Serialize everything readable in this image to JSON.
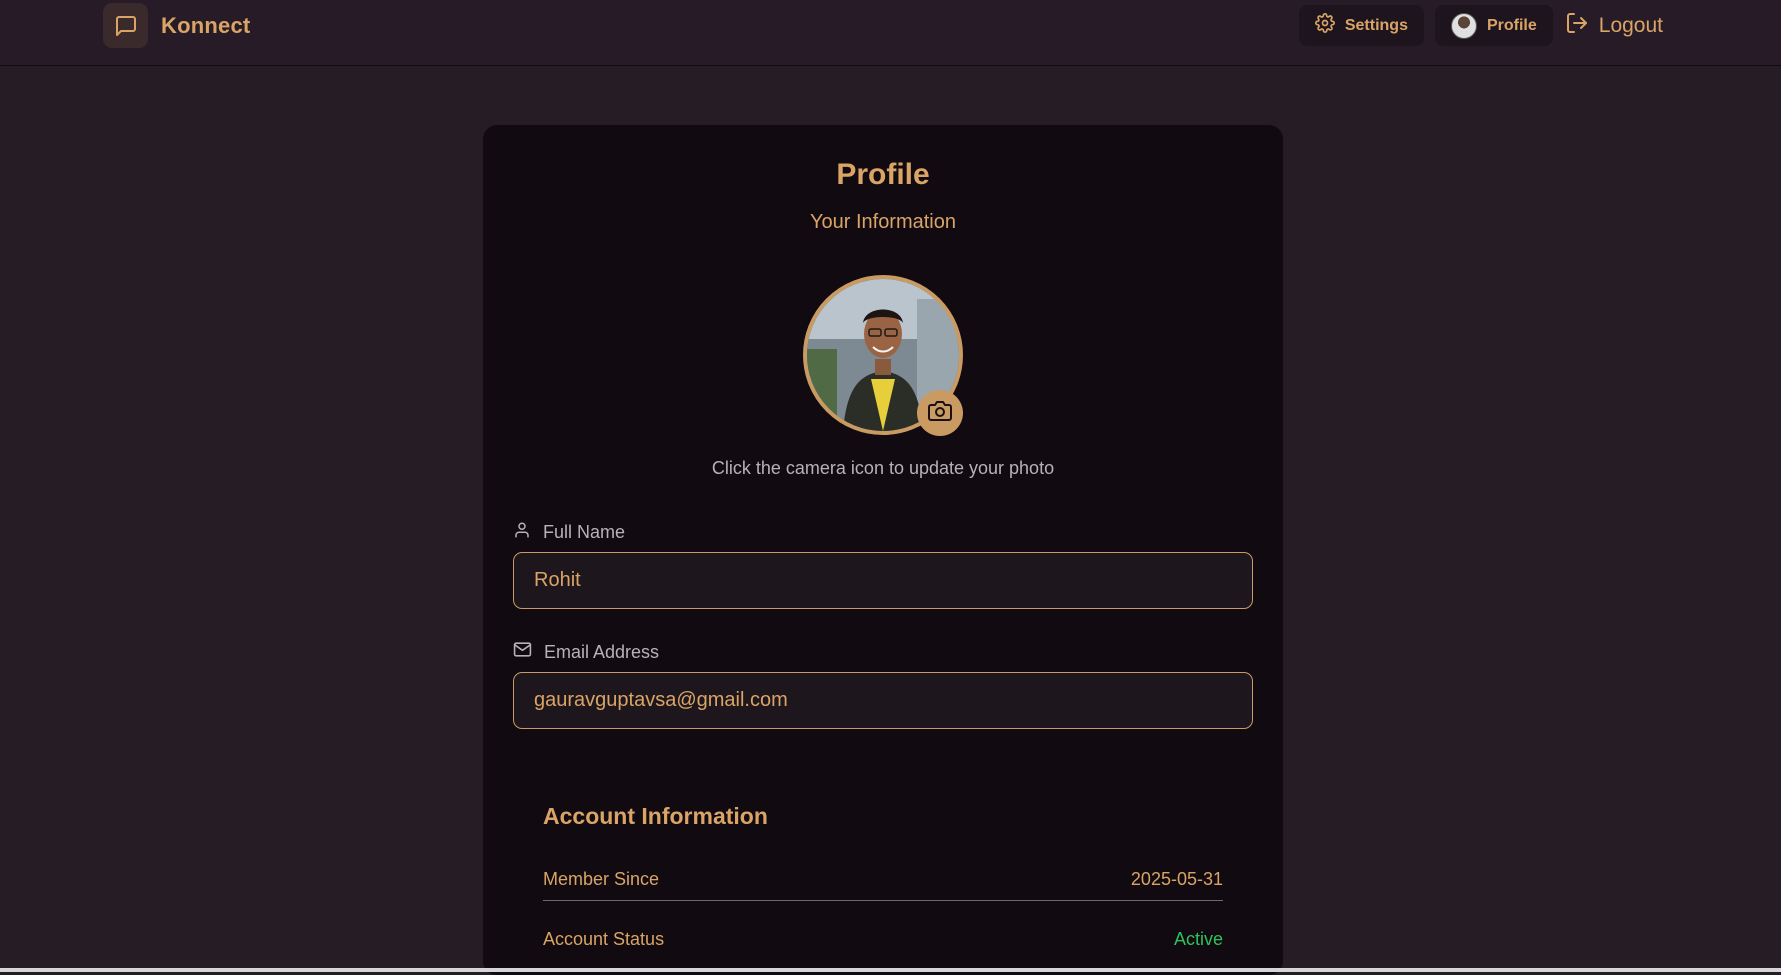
{
  "app": {
    "name": "Konnect",
    "brand_icon": "message-square-icon",
    "accent_color": "#d9a466"
  },
  "nav": {
    "settings_label": "Settings",
    "settings_icon": "gear-icon",
    "profile_label": "Profile",
    "logout_label": "Logout",
    "logout_icon": "logout-icon"
  },
  "profile": {
    "title": "Profile",
    "subtitle": "Your Information",
    "photo_hint": "Click the camera icon to update your photo",
    "camera_icon": "camera-icon",
    "fields": {
      "full_name": {
        "label": "Full Name",
        "icon": "user-icon",
        "value": "Rohit"
      },
      "email": {
        "label": "Email Address",
        "icon": "mail-icon",
        "value": "gauravguptavsa@gmail.com"
      }
    },
    "account": {
      "title": "Account Information",
      "member_since_label": "Member Since",
      "member_since_value": "2025-05-31",
      "status_label": "Account Status",
      "status_value": "Active",
      "status_color": "#2fc25a"
    }
  }
}
